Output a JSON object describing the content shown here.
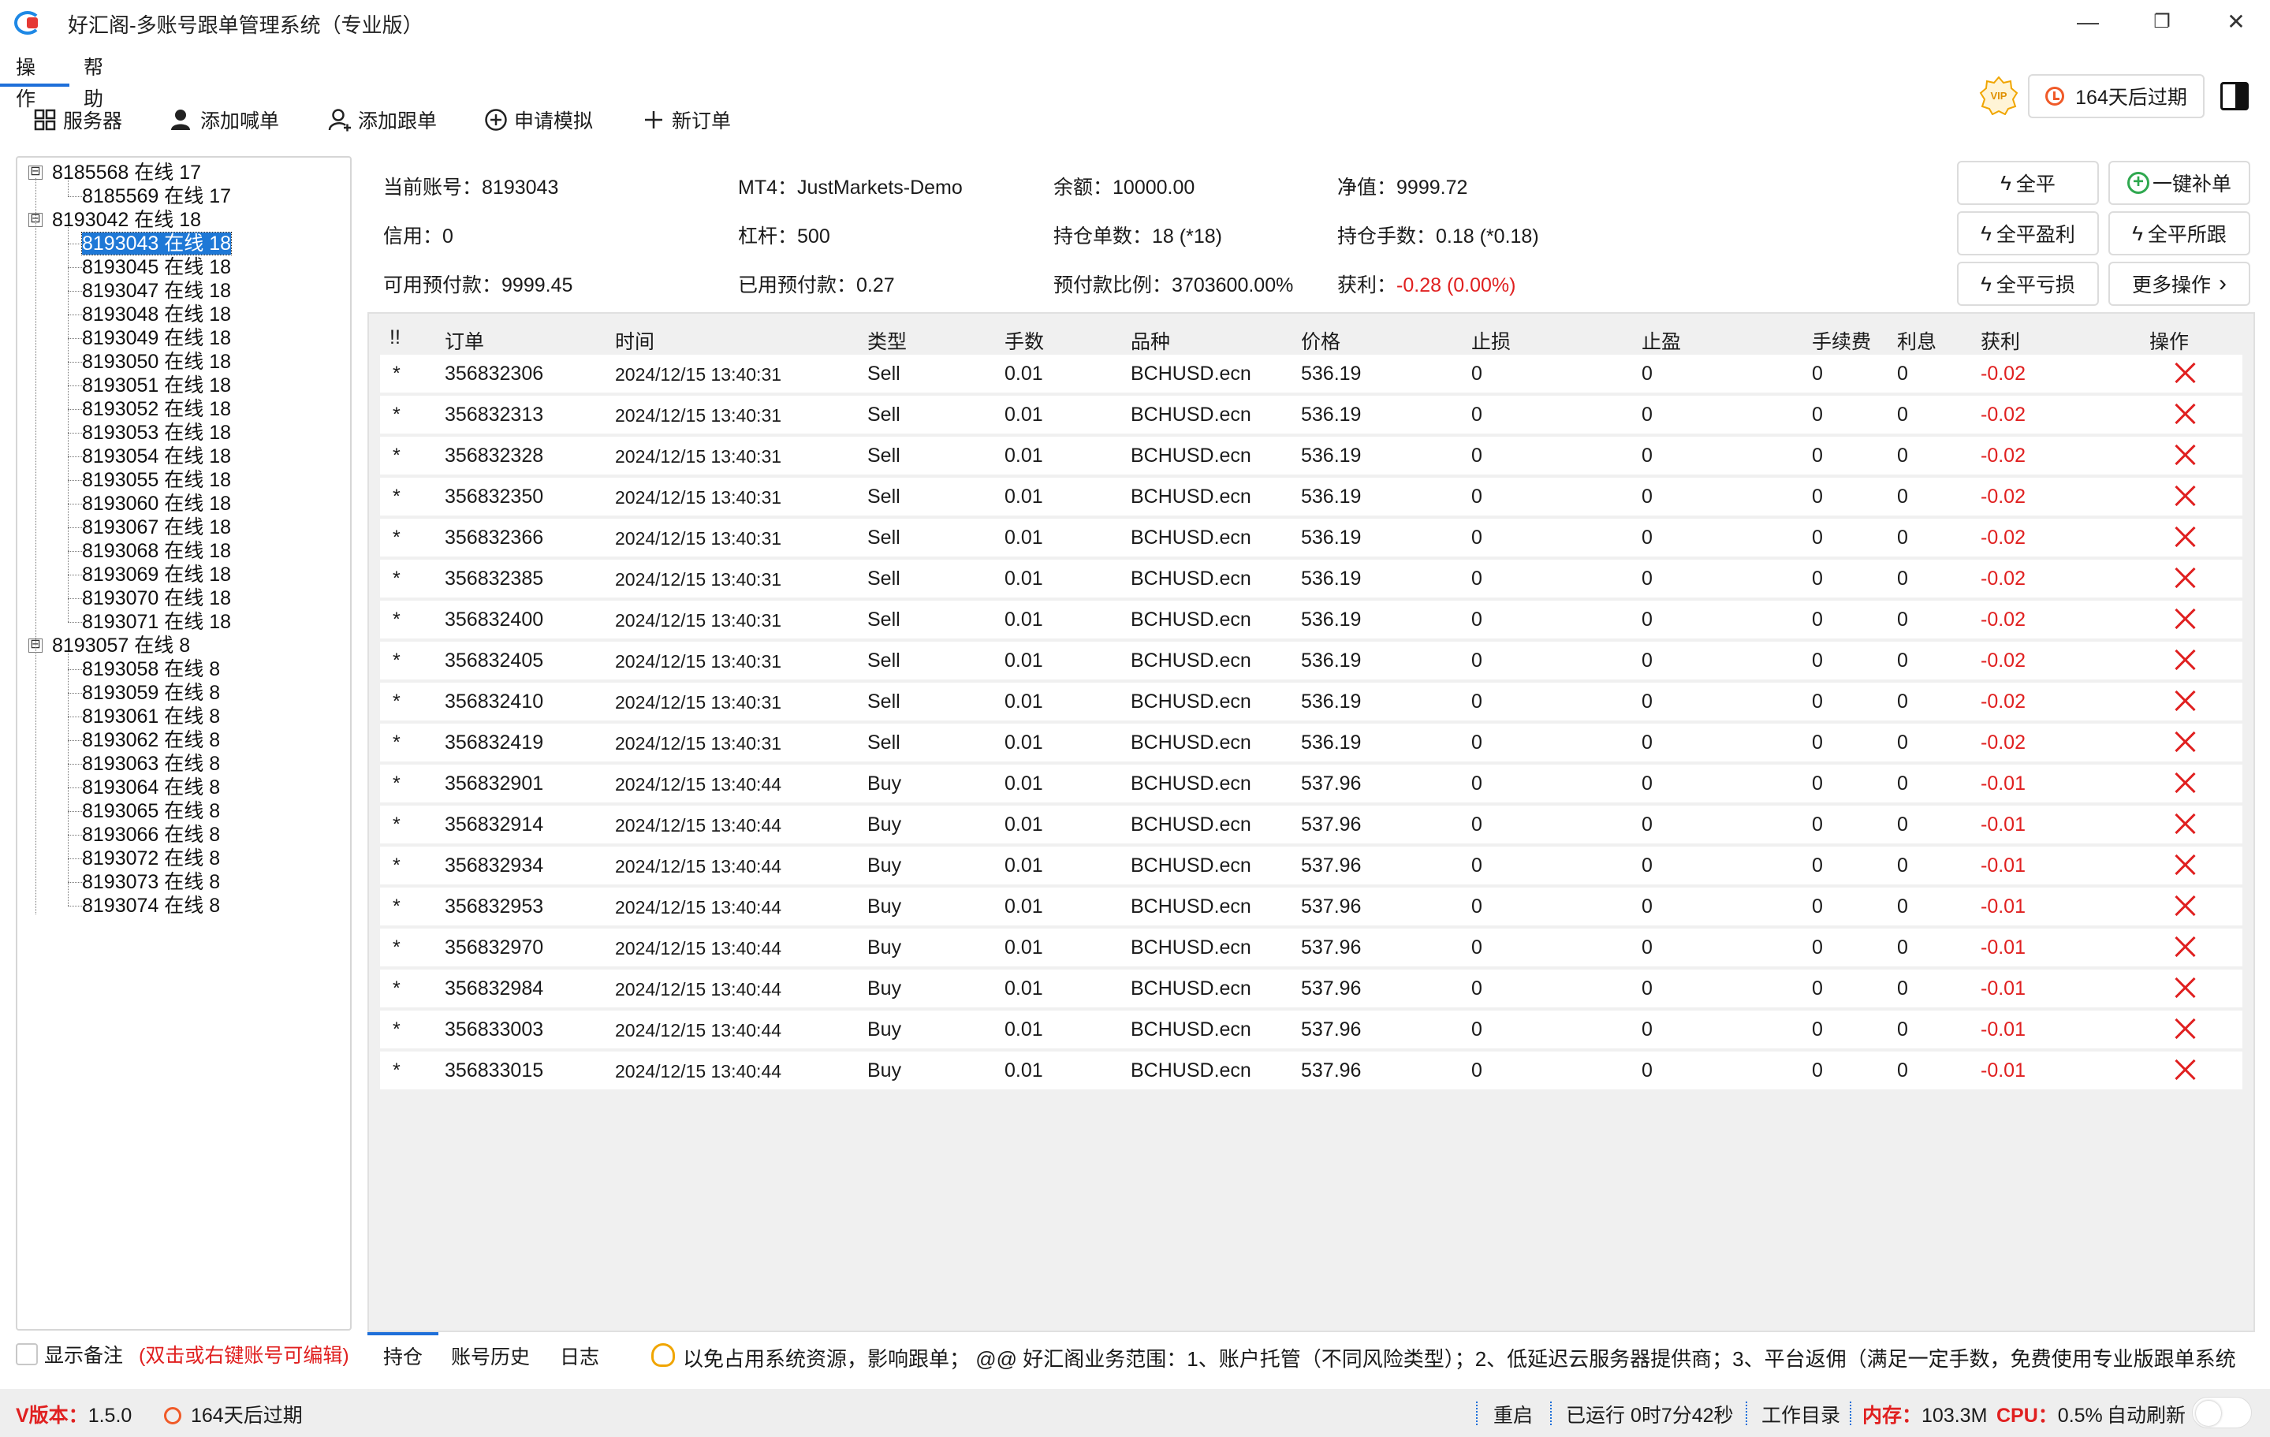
{
  "window": {
    "title": "好汇阁-多账号跟单管理系统（专业版）",
    "minimize": "—",
    "restore": "❐",
    "close": "✕"
  },
  "menu": {
    "operate": "操作",
    "help": "帮助"
  },
  "toolbar": {
    "servers": "服务器",
    "add_caller": "添加喊单",
    "add_follower": "添加跟单",
    "apply_demo": "申请模拟",
    "new_order": "新订单",
    "vip": "VIP",
    "expire": "164天后过期"
  },
  "tree": {
    "groups": [
      {
        "label": "8185568 在线 17",
        "children": [
          "8185569 在线 17"
        ]
      },
      {
        "label": "8193042 在线 18",
        "children": [
          "8193043 在线 18",
          "8193045 在线 18",
          "8193047 在线 18",
          "8193048 在线 18",
          "8193049 在线 18",
          "8193050 在线 18",
          "8193051 在线 18",
          "8193052 在线 18",
          "8193053 在线 18",
          "8193054 在线 18",
          "8193055 在线 18",
          "8193060 在线 18",
          "8193067 在线 18",
          "8193068 在线 18",
          "8193069 在线 18",
          "8193070 在线 18",
          "8193071 在线 18"
        ]
      },
      {
        "label": "8193057 在线 8",
        "children": [
          "8193058 在线 8",
          "8193059 在线 8",
          "8193061 在线 8",
          "8193062 在线 8",
          "8193063 在线 8",
          "8193064 在线 8",
          "8193065 在线 8",
          "8193066 在线 8",
          "8193072 在线 8",
          "8193073 在线 8",
          "8193074 在线 8"
        ]
      }
    ],
    "selected": "8193043 在线 18",
    "expand_glyph": "⊟"
  },
  "remark": {
    "label": "显示备注",
    "hint": "(双击或右键账号可编辑)"
  },
  "info": {
    "account_label": "当前账号：",
    "account": "8193043",
    "mt4_label": "MT4：",
    "mt4": "JustMarkets-Demo",
    "balance_label": "余额：",
    "balance": "10000.00",
    "equity_label": "净值：",
    "equity": "9999.72",
    "credit_label": "信用：",
    "credit": "0",
    "leverage_label": "杠杆：",
    "leverage": "500",
    "positions_label": "持仓单数：",
    "positions": "18 (*18)",
    "lots_label": "持仓手数：",
    "lots": "0.18 (*0.18)",
    "free_margin_label": "可用预付款：",
    "free_margin": "9999.45",
    "used_margin_label": "已用预付款：",
    "used_margin": "0.27",
    "margin_ratio_label": "预付款比例：",
    "margin_ratio": "3703600.00%",
    "profit_label": "获利：",
    "profit": "-0.28 (0.00%)"
  },
  "actions": {
    "close_all": "全平",
    "one_click_add": "一键补单",
    "close_profit": "全平盈利",
    "close_all_follow": "全平所跟",
    "close_loss": "全平亏损",
    "more": "更多操作",
    "bolt": "ϟ",
    "plus": "+",
    "chevron": "›"
  },
  "table": {
    "headers": [
      "!!",
      "订单",
      "时间",
      "类型",
      "手数",
      "品种",
      "价格",
      "止损",
      "止盈",
      "手续费",
      "利息",
      "获利",
      "操作"
    ],
    "rows": [
      [
        "*",
        "356832306",
        "2024/12/15 13:40:31",
        "Sell",
        "0.01",
        "BCHUSD.ecn",
        "536.19",
        "0",
        "0",
        "0",
        "0",
        "-0.02"
      ],
      [
        "*",
        "356832313",
        "2024/12/15 13:40:31",
        "Sell",
        "0.01",
        "BCHUSD.ecn",
        "536.19",
        "0",
        "0",
        "0",
        "0",
        "-0.02"
      ],
      [
        "*",
        "356832328",
        "2024/12/15 13:40:31",
        "Sell",
        "0.01",
        "BCHUSD.ecn",
        "536.19",
        "0",
        "0",
        "0",
        "0",
        "-0.02"
      ],
      [
        "*",
        "356832350",
        "2024/12/15 13:40:31",
        "Sell",
        "0.01",
        "BCHUSD.ecn",
        "536.19",
        "0",
        "0",
        "0",
        "0",
        "-0.02"
      ],
      [
        "*",
        "356832366",
        "2024/12/15 13:40:31",
        "Sell",
        "0.01",
        "BCHUSD.ecn",
        "536.19",
        "0",
        "0",
        "0",
        "0",
        "-0.02"
      ],
      [
        "*",
        "356832385",
        "2024/12/15 13:40:31",
        "Sell",
        "0.01",
        "BCHUSD.ecn",
        "536.19",
        "0",
        "0",
        "0",
        "0",
        "-0.02"
      ],
      [
        "*",
        "356832400",
        "2024/12/15 13:40:31",
        "Sell",
        "0.01",
        "BCHUSD.ecn",
        "536.19",
        "0",
        "0",
        "0",
        "0",
        "-0.02"
      ],
      [
        "*",
        "356832405",
        "2024/12/15 13:40:31",
        "Sell",
        "0.01",
        "BCHUSD.ecn",
        "536.19",
        "0",
        "0",
        "0",
        "0",
        "-0.02"
      ],
      [
        "*",
        "356832410",
        "2024/12/15 13:40:31",
        "Sell",
        "0.01",
        "BCHUSD.ecn",
        "536.19",
        "0",
        "0",
        "0",
        "0",
        "-0.02"
      ],
      [
        "*",
        "356832419",
        "2024/12/15 13:40:31",
        "Sell",
        "0.01",
        "BCHUSD.ecn",
        "536.19",
        "0",
        "0",
        "0",
        "0",
        "-0.02"
      ],
      [
        "*",
        "356832901",
        "2024/12/15 13:40:44",
        "Buy",
        "0.01",
        "BCHUSD.ecn",
        "537.96",
        "0",
        "0",
        "0",
        "0",
        "-0.01"
      ],
      [
        "*",
        "356832914",
        "2024/12/15 13:40:44",
        "Buy",
        "0.01",
        "BCHUSD.ecn",
        "537.96",
        "0",
        "0",
        "0",
        "0",
        "-0.01"
      ],
      [
        "*",
        "356832934",
        "2024/12/15 13:40:44",
        "Buy",
        "0.01",
        "BCHUSD.ecn",
        "537.96",
        "0",
        "0",
        "0",
        "0",
        "-0.01"
      ],
      [
        "*",
        "356832953",
        "2024/12/15 13:40:44",
        "Buy",
        "0.01",
        "BCHUSD.ecn",
        "537.96",
        "0",
        "0",
        "0",
        "0",
        "-0.01"
      ],
      [
        "*",
        "356832970",
        "2024/12/15 13:40:44",
        "Buy",
        "0.01",
        "BCHUSD.ecn",
        "537.96",
        "0",
        "0",
        "0",
        "0",
        "-0.01"
      ],
      [
        "*",
        "356832984",
        "2024/12/15 13:40:44",
        "Buy",
        "0.01",
        "BCHUSD.ecn",
        "537.96",
        "0",
        "0",
        "0",
        "0",
        "-0.01"
      ],
      [
        "*",
        "356833003",
        "2024/12/15 13:40:44",
        "Buy",
        "0.01",
        "BCHUSD.ecn",
        "537.96",
        "0",
        "0",
        "0",
        "0",
        "-0.01"
      ],
      [
        "*",
        "356833015",
        "2024/12/15 13:40:44",
        "Buy",
        "0.01",
        "BCHUSD.ecn",
        "537.96",
        "0",
        "0",
        "0",
        "0",
        "-0.01"
      ]
    ]
  },
  "bottom_tabs": {
    "positions": "持仓",
    "history": "账号历史",
    "log": "日志"
  },
  "marquee": "以免占用系统资源，影响跟单；   @@ 好汇阁业务范围：1、账户托管（不同风险类型）；2、低延迟云服务器提供商；3、平台返佣（满足一定手数，免费使用专业版跟单系统",
  "status": {
    "version_label": "V版本：",
    "version": "1.5.0",
    "expire": "164天后过期",
    "restart": "重启",
    "runtime": "已运行 0时7分42秒",
    "workdir": "工作目录",
    "memory_label": "内存：",
    "memory": "103.3M",
    "cpu_label": "CPU：",
    "cpu": "0.5%",
    "auto_refresh": "自动刷新"
  },
  "colors": {
    "accent": "#1e6fd9",
    "loss": "#e02020",
    "selected": "#1e78d6",
    "warn": "#f05a28"
  }
}
